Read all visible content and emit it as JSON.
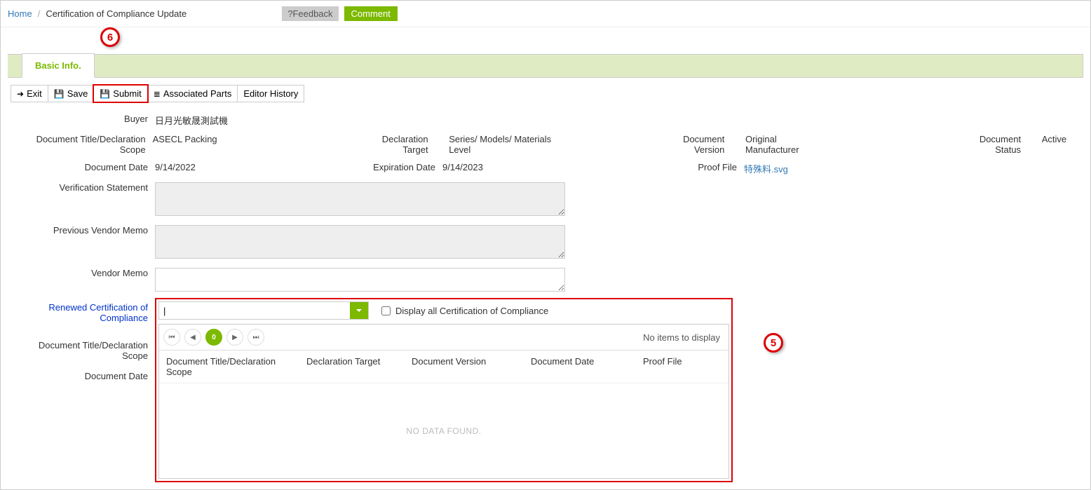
{
  "breadcrumb": {
    "home": "Home",
    "current": "Certification of Compliance Update"
  },
  "top_buttons": {
    "feedback": "?Feedback",
    "comment": "Comment"
  },
  "tab": {
    "basic_info": "Basic Info."
  },
  "toolbar": {
    "exit": "Exit",
    "save": "Save",
    "submit": "Submit",
    "assoc": "Associated Parts",
    "history": "Editor History"
  },
  "labels": {
    "buyer": "Buyer",
    "doc_title": "Document Title/Declaration Scope",
    "decl_target": "Declaration Target",
    "series": "Series/ Models/ Materials Level",
    "doc_version": "Document Version",
    "orig_mfr": "Original Manufacturer",
    "doc_status": "Document Status",
    "active": "Active",
    "doc_date": "Document Date",
    "exp_date": "Expiration Date",
    "proof_file": "Proof File",
    "verif": "Verification Statement",
    "prev_memo": "Previous Vendor Memo",
    "vendor_memo": "Vendor Memo",
    "renewed": "Renewed Certification of Compliance",
    "doc_title2": "Document Title/Declaration Scope",
    "doc_date2": "Document Date",
    "display_all": "Display all Certification of Compliance"
  },
  "values": {
    "buyer": "日月光敏晟測試機",
    "doc_title": "ASECL Packing",
    "doc_date": "9/14/2022",
    "exp_date": "9/14/2023",
    "proof_file": "特殊料.svg"
  },
  "pager": {
    "page": "0",
    "info": "No items to display"
  },
  "grid_headers": {
    "c1": "Document Title/Declaration Scope",
    "c2": "Declaration Target",
    "c3": "Document Version",
    "c4": "Document Date",
    "c5": "Proof File"
  },
  "grid_empty": "NO DATA FOUND.",
  "callout5": "5",
  "callout6": "6"
}
